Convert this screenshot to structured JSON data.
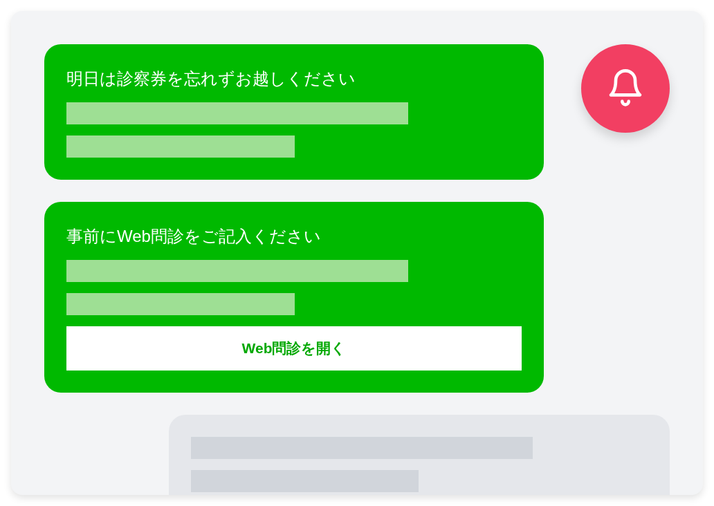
{
  "messages": [
    {
      "kind": "notice",
      "text": "明日は診察券を忘れずお越しください"
    },
    {
      "kind": "notice",
      "text": "事前にWeb問診をご記入ください",
      "button": "Web問診を開く"
    },
    {
      "kind": "incoming"
    }
  ]
}
